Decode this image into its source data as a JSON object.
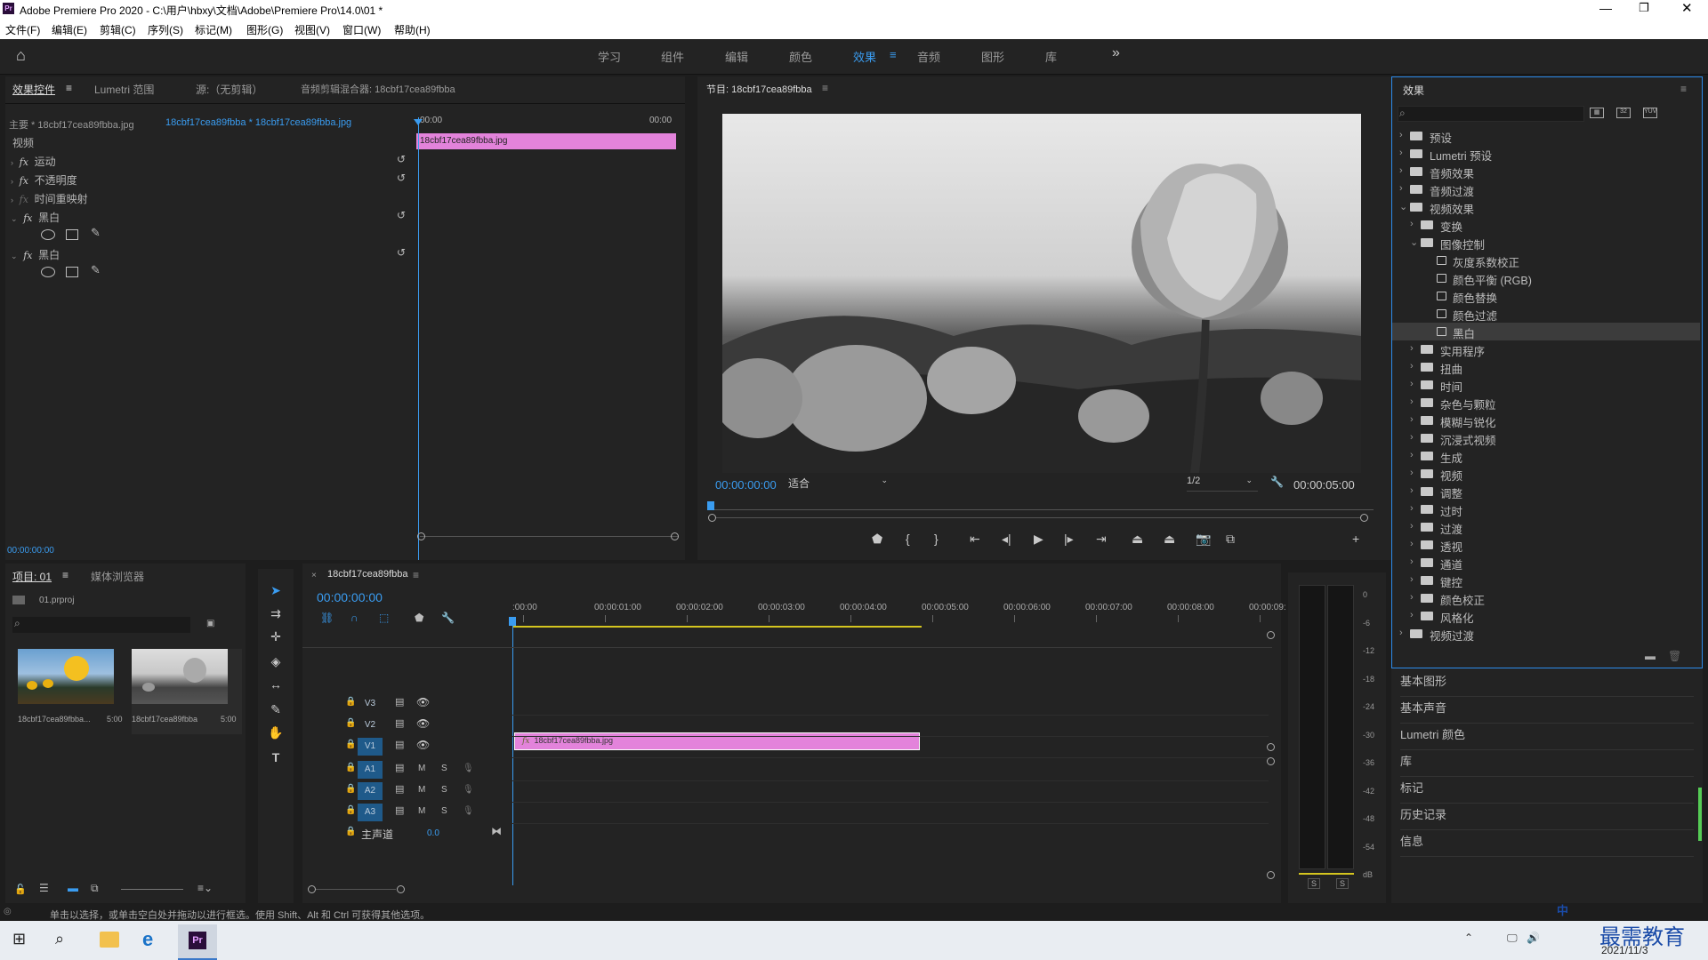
{
  "window": {
    "title": "Adobe Premiere Pro 2020 - C:\\用户\\hbxy\\文档\\Adobe\\Premiere Pro\\14.0\\01 *",
    "app_icon": "Pr"
  },
  "menu": [
    "文件(F)",
    "编辑(E)",
    "剪辑(C)",
    "序列(S)",
    "标记(M)",
    "图形(G)",
    "视图(V)",
    "窗口(W)",
    "帮助(H)"
  ],
  "workspaces": {
    "items": [
      "学习",
      "组件",
      "编辑",
      "颜色",
      "效果",
      "音频",
      "图形",
      "库"
    ],
    "active": "效果",
    "more": "»"
  },
  "effect_controls": {
    "tabs": [
      "效果控件",
      "Lumetri 范围",
      "源:（无剪辑）",
      "音频剪辑混合器: 18cbf17cea89fbba"
    ],
    "master": "主要 * 18cbf17cea89fbba.jpg",
    "clip": "18cbf17cea89fbba * 18cbf17cea89fbba.jpg",
    "time_start": "00:00",
    "time_end": "00:00",
    "clip_bar": "18cbf17cea89fbba.jpg",
    "section": "视频",
    "effects": [
      "运动",
      "不透明度",
      "时间重映射",
      "黑白",
      "黑白"
    ],
    "fx_label": "fx",
    "timecode": "00:00:00:00"
  },
  "program": {
    "title": "节目: 18cbf17cea89fbba",
    "timecode": "00:00:00:00",
    "fit": "适合",
    "quality": "1/2",
    "duration": "00:00:05:00"
  },
  "effects_panel": {
    "title": "效果",
    "tree": [
      {
        "label": "预设",
        "level": 0,
        "kind": "folder",
        "open": false
      },
      {
        "label": "Lumetri 预设",
        "level": 0,
        "kind": "folder",
        "open": false
      },
      {
        "label": "音频效果",
        "level": 0,
        "kind": "folder",
        "open": false
      },
      {
        "label": "音频过渡",
        "level": 0,
        "kind": "folder",
        "open": false
      },
      {
        "label": "视频效果",
        "level": 0,
        "kind": "folder",
        "open": true
      },
      {
        "label": "变换",
        "level": 1,
        "kind": "folder",
        "open": false
      },
      {
        "label": "图像控制",
        "level": 1,
        "kind": "folder",
        "open": true
      },
      {
        "label": "灰度系数校正",
        "level": 2,
        "kind": "fx"
      },
      {
        "label": "颜色平衡 (RGB)",
        "level": 2,
        "kind": "fx"
      },
      {
        "label": "颜色替换",
        "level": 2,
        "kind": "fx"
      },
      {
        "label": "颜色过滤",
        "level": 2,
        "kind": "fx"
      },
      {
        "label": "黑白",
        "level": 2,
        "kind": "fx",
        "selected": true
      },
      {
        "label": "实用程序",
        "level": 1,
        "kind": "folder",
        "open": false
      },
      {
        "label": "扭曲",
        "level": 1,
        "kind": "folder",
        "open": false
      },
      {
        "label": "时间",
        "level": 1,
        "kind": "folder",
        "open": false
      },
      {
        "label": "杂色与颗粒",
        "level": 1,
        "kind": "folder",
        "open": false
      },
      {
        "label": "模糊与锐化",
        "level": 1,
        "kind": "folder",
        "open": false
      },
      {
        "label": "沉浸式视频",
        "level": 1,
        "kind": "folder",
        "open": false
      },
      {
        "label": "生成",
        "level": 1,
        "kind": "folder",
        "open": false
      },
      {
        "label": "视频",
        "level": 1,
        "kind": "folder",
        "open": false
      },
      {
        "label": "调整",
        "level": 1,
        "kind": "folder",
        "open": false
      },
      {
        "label": "过时",
        "level": 1,
        "kind": "folder",
        "open": false
      },
      {
        "label": "过渡",
        "level": 1,
        "kind": "folder",
        "open": false
      },
      {
        "label": "透视",
        "level": 1,
        "kind": "folder",
        "open": false
      },
      {
        "label": "通道",
        "level": 1,
        "kind": "folder",
        "open": false
      },
      {
        "label": "键控",
        "level": 1,
        "kind": "folder",
        "open": false
      },
      {
        "label": "颜色校正",
        "level": 1,
        "kind": "folder",
        "open": false
      },
      {
        "label": "风格化",
        "level": 1,
        "kind": "folder",
        "open": false
      },
      {
        "label": "视频过渡",
        "level": 0,
        "kind": "folder",
        "open": false
      }
    ],
    "side": [
      "基本图形",
      "基本声音",
      "Lumetri 颜色",
      "库",
      "标记",
      "历史记录",
      "信息"
    ]
  },
  "project": {
    "tabs": [
      "项目: 01",
      "媒体浏览器"
    ],
    "file": "01.prproj",
    "items": [
      {
        "name": "18cbf17cea89fbba...",
        "dur": "5:00"
      },
      {
        "name": "18cbf17cea89fbba",
        "dur": "5:00"
      }
    ]
  },
  "timeline": {
    "seq": "18cbf17cea89fbba",
    "timecode": "00:00:00:00",
    "ruler": [
      ":00:00",
      "00:00:01:00",
      "00:00:02:00",
      "00:00:03:00",
      "00:00:04:00",
      "00:00:05:00",
      "00:00:06:00",
      "00:00:07:00",
      "00:00:08:00",
      "00:00:09:"
    ],
    "tracks": [
      "V3",
      "V2",
      "V1",
      "A1",
      "A2",
      "A3"
    ],
    "master": "主声道",
    "master_val": "0.0",
    "clip": "18cbf17cea89fbba.jpg",
    "clip_fx": "fx",
    "mute": "M",
    "solo": "S"
  },
  "meter": {
    "scale": [
      "0",
      "-6",
      "-12",
      "-18",
      "-24",
      "-30",
      "-36",
      "-42",
      "-48",
      "-54",
      "dB"
    ],
    "solo": "S"
  },
  "status": "单击以选择，或单击空白处并拖动以进行框选。使用 Shift、Alt 和 Ctrl 可获得其他选项。",
  "taskbar": {
    "date": "2021/11/3",
    "ime": "中",
    "watermark": "最需教育"
  },
  "colors": {
    "accent": "#3a9cf0",
    "clip": "#e383db",
    "panel": "#232323"
  }
}
